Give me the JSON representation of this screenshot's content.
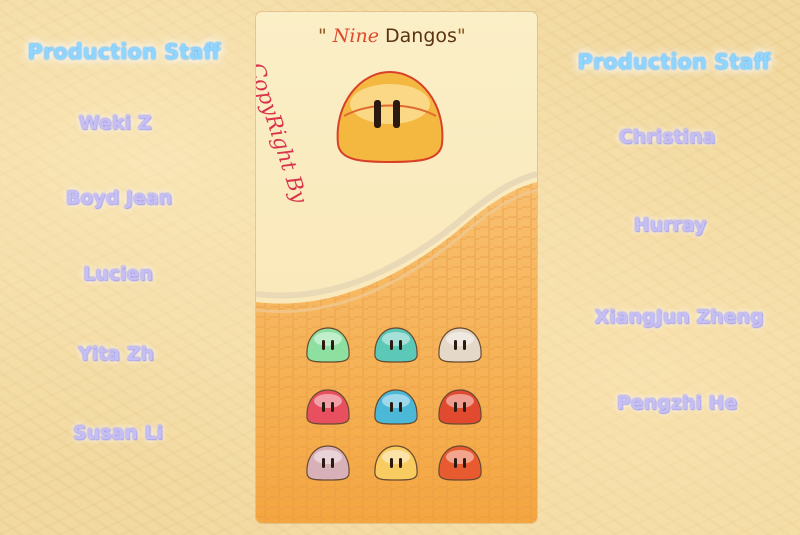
{
  "left_panel": {
    "heading": "Production Staff",
    "names": [
      "Weki Z",
      "Boyd Jean",
      "Lucien",
      "Yita Zh",
      "Susan Li"
    ]
  },
  "right_panel": {
    "heading": "Production Staff",
    "names": [
      "Christina",
      "Hurray",
      "XiangJun Zheng",
      "Pengzhi He"
    ]
  },
  "card": {
    "title_quote_open": "\"",
    "title_word_1": "Nine",
    "title_word_2": "Dangos",
    "title_quote_close": "\"",
    "copyright": "CopyRight By",
    "dango_colors": [
      "#8ee0a0",
      "#5cc8b8",
      "#e4d8c8",
      "#e85060",
      "#4cb8d8",
      "#e24a30",
      "#d8b0b8",
      "#f8cc60",
      "#e85a30"
    ],
    "big_dango_color": "#f4b840"
  }
}
